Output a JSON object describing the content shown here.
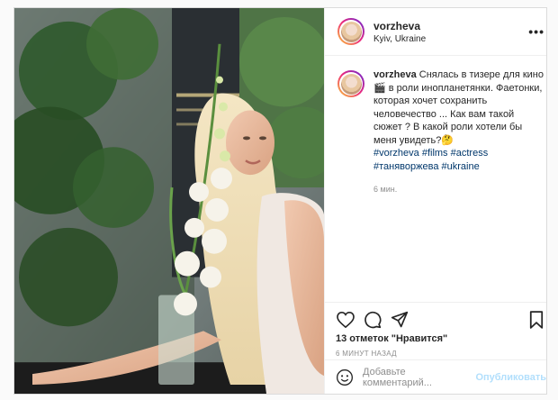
{
  "post": {
    "username": "vorzheva",
    "location": "Kyiv, Ukraine",
    "more_label": "•••",
    "caption": {
      "username": "vorzheva",
      "text": "Снялась в тизере для кино 🎬 в роли инопланетянки. Фаетонки, которая хочет сохранить человечество ... Как вам такой сюжет ? В какой роли хотели бы меня увидеть?🤔",
      "hashtags": [
        "#vorzheva",
        "#films",
        "#actress",
        "#таняворжева",
        "#ukraine"
      ],
      "time": "6 мин."
    },
    "icons": [
      "heart-icon",
      "comment-icon",
      "share-icon",
      "bookmark-icon",
      "emoji-icon"
    ],
    "likes": "13 отметок \"Нравится\"",
    "posted_ago": "6 МИНУТ НАЗАД",
    "comment_placeholder": "Добавьте комментарий...",
    "publish_label": "Опубликовать"
  },
  "colors": {
    "text": "#262626",
    "secondary": "#8e8e8e",
    "link": "#00376b",
    "publish_disabled": "#b2dffc",
    "border": "#dbdbdb"
  }
}
